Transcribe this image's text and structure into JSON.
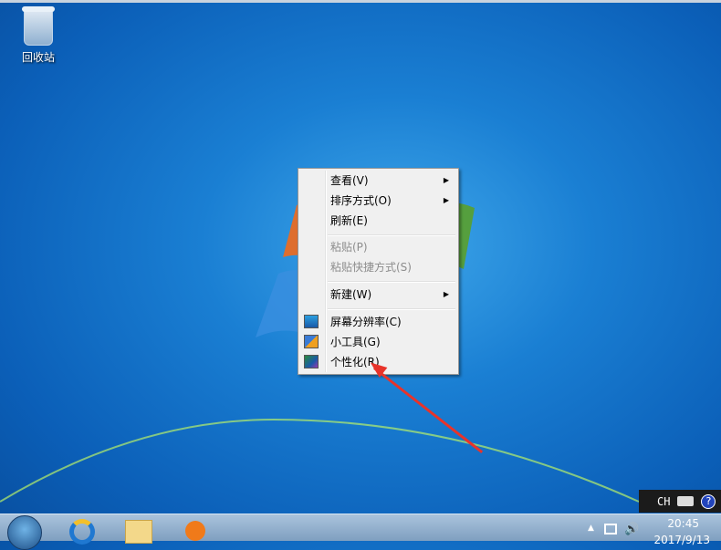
{
  "desktop": {
    "icons": [
      {
        "label": "回收站",
        "icon": "recycle-bin-icon"
      }
    ]
  },
  "context_menu": {
    "items": [
      {
        "label": "查看(V)",
        "submenu": true,
        "disabled": false
      },
      {
        "label": "排序方式(O)",
        "submenu": true,
        "disabled": false
      },
      {
        "label": "刷新(E)",
        "submenu": false,
        "disabled": false
      },
      {
        "label": "粘贴(P)",
        "submenu": false,
        "disabled": true
      },
      {
        "label": "粘贴快捷方式(S)",
        "submenu": false,
        "disabled": true
      },
      {
        "label": "新建(W)",
        "submenu": true,
        "disabled": false
      },
      {
        "label": "屏幕分辨率(C)",
        "submenu": false,
        "disabled": false,
        "icon": "display-resolution-icon"
      },
      {
        "label": "小工具(G)",
        "submenu": false,
        "disabled": false,
        "icon": "gadgets-icon"
      },
      {
        "label": "个性化(R)",
        "submenu": false,
        "disabled": false,
        "icon": "personalize-icon"
      }
    ],
    "submenu_arrow": "▶"
  },
  "language_bar": {
    "lang": "CH",
    "help": "?"
  },
  "taskbar": {
    "pinned": [
      "internet-explorer-icon",
      "file-explorer-icon",
      "media-player-icon"
    ],
    "tray": {
      "show_hidden": "▲",
      "time": "20:45",
      "date": "2017/9/13"
    }
  },
  "colors": {
    "annotation_arrow": "#e8332a"
  }
}
